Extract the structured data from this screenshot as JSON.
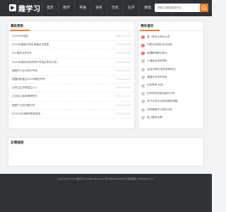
{
  "site": {
    "name": "趣学习"
  },
  "nav": {
    "items": [
      "首页",
      "数学",
      "英语",
      "体育",
      "历史",
      "化学",
      "物理",
      "生物"
    ]
  },
  "search": {
    "placeholder": "请输入您要搜索的内容"
  },
  "latest": {
    "title": "最新更新",
    "items": [
      {
        "title": "2023大专招生",
        "date": "2024-11-02"
      },
      {
        "title": "2023年国家中专生资格证书发放",
        "date": "2024-11-02"
      },
      {
        "title": "211重庆大学共6",
        "date": "2024-11-02"
      },
      {
        "title": "2022年湖北师范学院中专招生考试计划...",
        "date": "2024-11-02"
      },
      {
        "title": "南阳市工业大学中专校",
        "date": "2024-11-02"
      },
      {
        "title": "德国防疫是否什么有哪些专科",
        "date": "2024-11-02"
      },
      {
        "title": "吉林卫生学院招生211",
        "date": "2024-11-02"
      },
      {
        "title": "兰州成人高考报考条件",
        "date": "2024-11-02"
      },
      {
        "title": "国家产业设计着中专",
        "date": "2024-11-02"
      },
      {
        "title": "RCS10艺术教学机构排名",
        "date": "2024-11-02"
      }
    ]
  },
  "ranking": {
    "title": "猜你喜欢",
    "items": [
      "高一学位及专业大学",
      "中职大专招生专业目标",
      "地理教师职业考试",
      "上海适合本科院校",
      "北京计算机 城市考研科目",
      "德国大学本科排名 ",
      "化学考研 比较",
      "历史研究全部大部分中专",
      "关于大学生与其年龄的问题",
      "专科课程学习历史分析",
      "成人高考日期"
    ]
  },
  "links": {
    "title": "友情链接"
  },
  "footer": {
    "copyright": "Copyright © 2023 趣学习 All Rights Reserved. 粤ICP备2023000000号 联系邮箱：office@xxx.com"
  }
}
